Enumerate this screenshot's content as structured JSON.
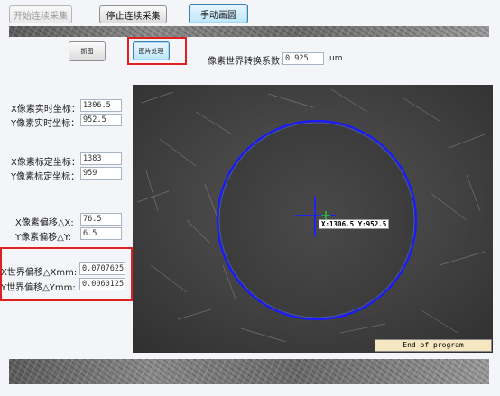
{
  "toolbar": {
    "start_capture": "开始连续采集",
    "stop_capture": "停止连续采集",
    "manual_draw": "手动画圆"
  },
  "actions": {
    "capture": "抓图",
    "process": "图片处理"
  },
  "conversion": {
    "label": "像素世界转换系数：",
    "value": "0.925",
    "unit": "um"
  },
  "realtime": {
    "x_label": "X像素实时坐标：",
    "x_value": "1306.5",
    "y_label": "Y像素实时坐标：",
    "y_value": "952.5"
  },
  "calibration": {
    "x_label": "X像素标定坐标：",
    "x_value": "1383",
    "y_label": "Y像素标定坐标：",
    "y_value": "959"
  },
  "pixel_offset": {
    "x_label": "X像素偏移△X:",
    "x_value": "76.5",
    "y_label": "Y像素偏移△Y:",
    "y_value": "6.5"
  },
  "world_offset": {
    "x_label": "X世界偏移△Xmm:",
    "x_value": "0.0707625",
    "y_label": "Y世界偏移△Ymm:",
    "y_value": "0.0060125"
  },
  "viewer": {
    "coord_text": "X:1306.5 Y:952.5",
    "status_text": "End of program",
    "circle_color": "#1a1aff",
    "cross_color": "#2222ee",
    "marker_color": "#22cc22"
  }
}
